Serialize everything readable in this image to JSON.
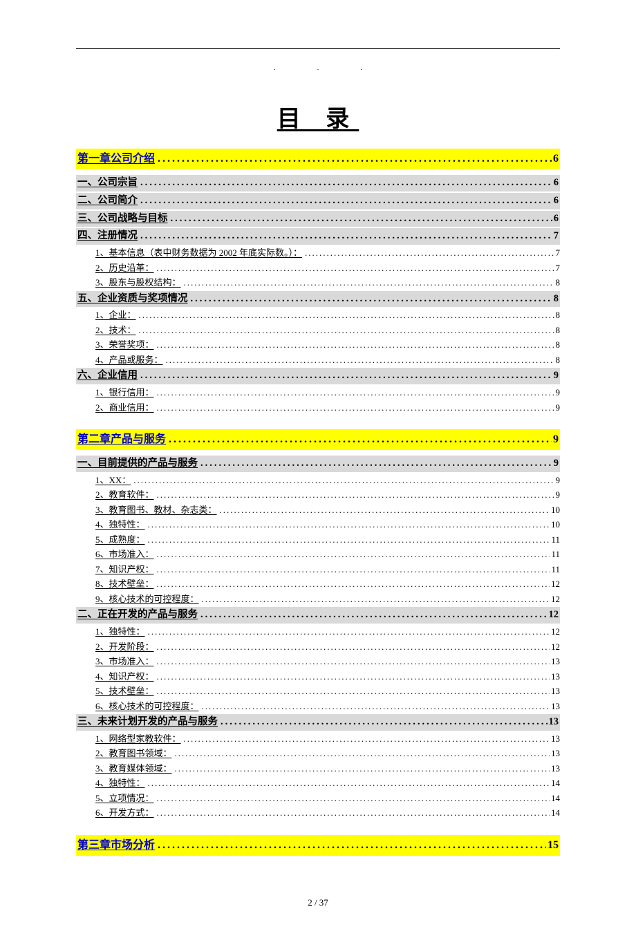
{
  "header_dots": ". . .",
  "title": "目 录",
  "footer": "2 / 37",
  "toc": [
    {
      "level": 1,
      "label": "第一章公司介绍",
      "page": "6"
    },
    {
      "level": 2,
      "label": "一、公司宗旨",
      "page": "6"
    },
    {
      "level": 2,
      "label": "二、公司简介",
      "page": "6"
    },
    {
      "level": 2,
      "label": "三、公司战略与目标",
      "page": "6"
    },
    {
      "level": 2,
      "label": "四、注册情况",
      "page": "7"
    },
    {
      "level": 3,
      "label": "1、基本信息（表中财务数据为 2002 年底实际数。）：",
      "page": "7"
    },
    {
      "level": 3,
      "label": "2、历史沿革：",
      "page": "7"
    },
    {
      "level": 3,
      "label": "3、股东与股权结构：",
      "page": "8"
    },
    {
      "level": 2,
      "label": "五、企业资质与奖项情况",
      "page": "8"
    },
    {
      "level": 3,
      "label": "1、企业：",
      "page": "8"
    },
    {
      "level": 3,
      "label": "2、技术：",
      "page": "8"
    },
    {
      "level": 3,
      "label": "3、荣誉奖项：",
      "page": "8"
    },
    {
      "level": 3,
      "label": "4、产品或服务：",
      "page": "8"
    },
    {
      "level": 2,
      "label": "六、企业信用",
      "page": "9"
    },
    {
      "level": 3,
      "label": "1、银行信用：",
      "page": "9"
    },
    {
      "level": 3,
      "label": "2、商业信用：",
      "page": "9"
    },
    {
      "level": 1,
      "label": "第二章产品与服务",
      "page": "9"
    },
    {
      "level": 2,
      "label": "一、目前提供的产品与服务",
      "page": "9"
    },
    {
      "level": 3,
      "label": "1、XX：",
      "page": "9"
    },
    {
      "level": 3,
      "label": "2、教育软件：",
      "page": "9"
    },
    {
      "level": 3,
      "label": "3、教育图书、教材、杂志类：",
      "page": "10"
    },
    {
      "level": 3,
      "label": "4、独特性：",
      "page": "10"
    },
    {
      "level": 3,
      "label": "5、成熟度：",
      "page": "11"
    },
    {
      "level": 3,
      "label": "6、市场准入：",
      "page": "11"
    },
    {
      "level": 3,
      "label": "7、知识产权：",
      "page": "11"
    },
    {
      "level": 3,
      "label": "8、技术壁垒：",
      "page": "12"
    },
    {
      "level": 3,
      "label": "9、核心技术的可控程度：",
      "page": "12"
    },
    {
      "level": 2,
      "label": "二、正在开发的产品与服务",
      "page": "12"
    },
    {
      "level": 3,
      "label": "1、独特性：",
      "page": "12"
    },
    {
      "level": 3,
      "label": "2、开发阶段：",
      "page": "12"
    },
    {
      "level": 3,
      "label": "3、市场准入：",
      "page": "13"
    },
    {
      "level": 3,
      "label": "4、知识产权：",
      "page": "13"
    },
    {
      "level": 3,
      "label": "5、技术壁垒：",
      "page": "13"
    },
    {
      "level": 3,
      "label": "6、核心技术的可控程度：",
      "page": "13"
    },
    {
      "level": 2,
      "label": "三、未来计划开发的产品与服务",
      "page": "13"
    },
    {
      "level": 3,
      "label": "1、网络型家教软件：",
      "page": "13"
    },
    {
      "level": 3,
      "label": "2、教育图书领域：",
      "page": "13"
    },
    {
      "level": 3,
      "label": "3、教育媒体领域：",
      "page": "13"
    },
    {
      "level": 3,
      "label": "4、独特性：",
      "page": "14"
    },
    {
      "level": 3,
      "label": "5、立项情况：",
      "page": "14"
    },
    {
      "level": 3,
      "label": "6、开发方式：",
      "page": "14"
    },
    {
      "level": 1,
      "label": "第三章市场分析",
      "page": "15"
    }
  ]
}
